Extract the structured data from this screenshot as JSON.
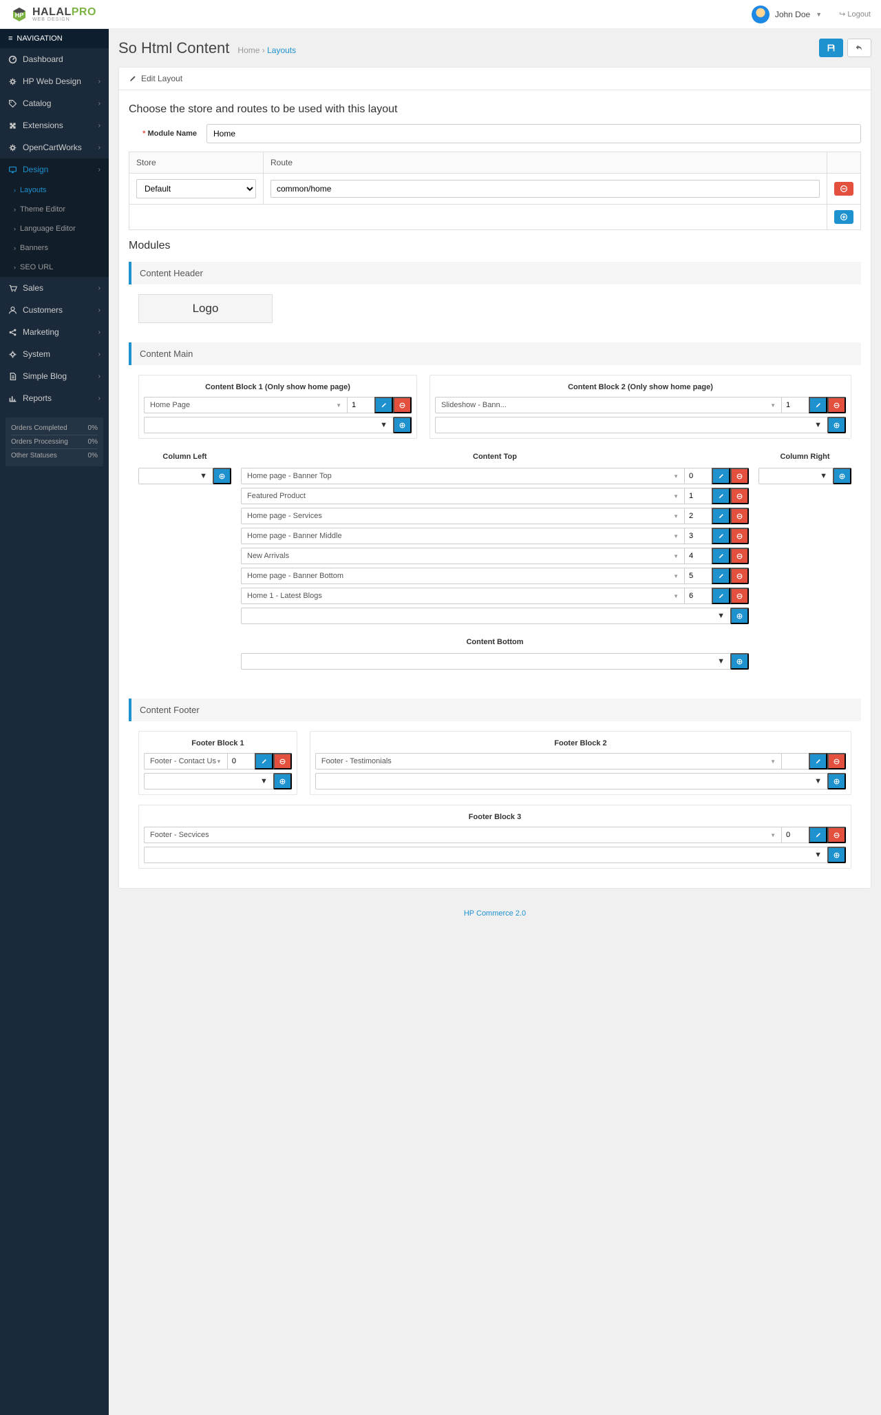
{
  "brand": {
    "name1": "HALAL",
    "name2": "PRO",
    "sub": "WEB DESIGN"
  },
  "user": {
    "name": "John Doe",
    "logout": "Logout"
  },
  "nav": {
    "header": "NAVIGATION",
    "items": [
      {
        "icon": "dashboard",
        "label": "Dashboard",
        "chev": false
      },
      {
        "icon": "cogs",
        "label": "HP Web Design",
        "chev": true
      },
      {
        "icon": "tag",
        "label": "Catalog",
        "chev": true
      },
      {
        "icon": "puzzle",
        "label": "Extensions",
        "chev": true
      },
      {
        "icon": "cogs",
        "label": "OpenCartWorks",
        "chev": true
      },
      {
        "icon": "desktop",
        "label": "Design",
        "chev": true,
        "active": true
      },
      {
        "icon": "cart",
        "label": "Sales",
        "chev": true
      },
      {
        "icon": "user",
        "label": "Customers",
        "chev": true
      },
      {
        "icon": "share",
        "label": "Marketing",
        "chev": true
      },
      {
        "icon": "gear",
        "label": "System",
        "chev": true
      },
      {
        "icon": "file",
        "label": "Simple Blog",
        "chev": true
      },
      {
        "icon": "chart",
        "label": "Reports",
        "chev": true
      }
    ],
    "design_sub": [
      {
        "label": "Layouts",
        "active": true
      },
      {
        "label": "Theme Editor"
      },
      {
        "label": "Language Editor"
      },
      {
        "label": "Banners"
      },
      {
        "label": "SEO URL"
      }
    ],
    "status": [
      {
        "label": "Orders Completed",
        "val": "0%"
      },
      {
        "label": "Orders Processing",
        "val": "0%"
      },
      {
        "label": "Other Statuses",
        "val": "0%"
      }
    ]
  },
  "page": {
    "title": "So Html Content",
    "crumb_home": "Home",
    "crumb_current": "Layouts",
    "edit_heading": "Edit Layout",
    "subtitle": "Choose the store and routes to be used with this layout",
    "module_name_label": "Module Name",
    "module_name_value": "Home",
    "table": {
      "th_store": "Store",
      "th_route": "Route",
      "store": "Default",
      "route": "common/home"
    },
    "modules_heading": "Modules"
  },
  "sections": {
    "header": {
      "title": "Content Header",
      "logo": "Logo"
    },
    "main": {
      "title": "Content Main",
      "block1": {
        "title": "Content Block 1 (Only show home page)",
        "module": "Home Page",
        "order": "1"
      },
      "block2": {
        "title": "Content Block 2 (Only show home page)",
        "module": "Slideshow - Bann...",
        "order": "1"
      },
      "col_left": "Column Left",
      "col_right": "Column Right",
      "content_top": {
        "title": "Content Top",
        "rows": [
          {
            "module": "Home page - Banner Top",
            "order": "0"
          },
          {
            "module": "Featured Product",
            "order": "1"
          },
          {
            "module": "Home page - Services",
            "order": "2"
          },
          {
            "module": "Home page - Banner Middle",
            "order": "3"
          },
          {
            "module": "New Arrivals",
            "order": "4"
          },
          {
            "module": "Home page - Banner Bottom",
            "order": "5"
          },
          {
            "module": "Home 1 - Latest Blogs",
            "order": "6"
          }
        ]
      },
      "content_bottom": "Content Bottom"
    },
    "footer": {
      "title": "Content Footer",
      "block1": {
        "title": "Footer Block 1",
        "module": "Footer - Contact Us",
        "order": "0"
      },
      "block2": {
        "title": "Footer Block 2",
        "module": "Footer - Testimonials",
        "order": ""
      },
      "block3": {
        "title": "Footer Block 3",
        "module": "Footer - Secvices",
        "order": "0"
      }
    }
  },
  "footer_text": "HP Commerce 2.0"
}
